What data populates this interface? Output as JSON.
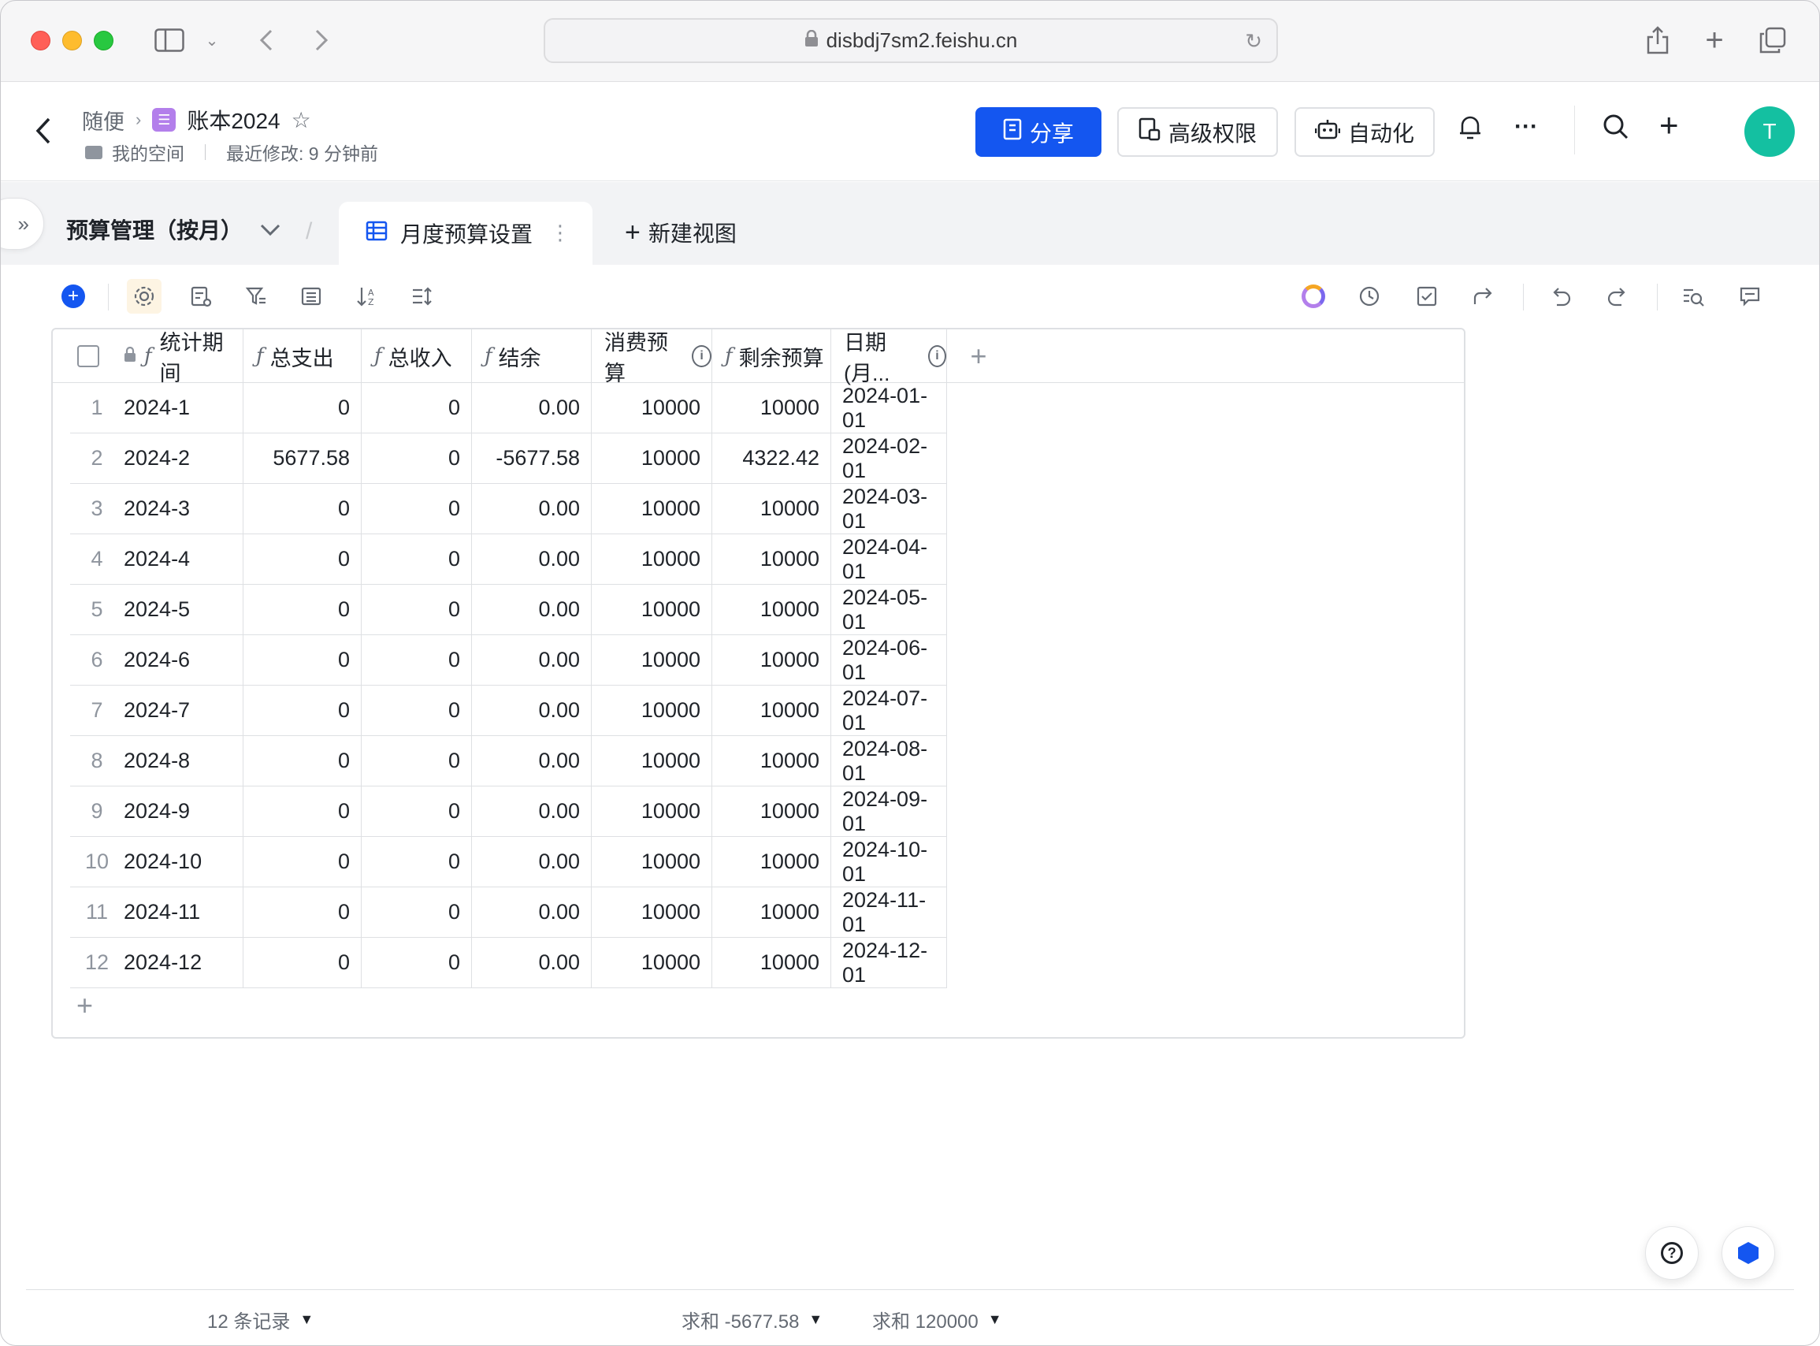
{
  "browser": {
    "url": "disbdj7sm2.feishu.cn"
  },
  "header": {
    "breadcrumb_parent": "随便",
    "doc_title": "账本2024",
    "space_name": "我的空间",
    "last_modified": "最近修改: 9 分钟前",
    "share_label": "分享",
    "permissions_label": "高级权限",
    "automation_label": "自动化",
    "avatar_initial": "T",
    "more_label": "···"
  },
  "tabs": {
    "table_name": "预算管理（按月）",
    "active_view": "月度预算设置",
    "new_view_label": "新建视图"
  },
  "grid": {
    "columns": [
      {
        "label": "统计期间",
        "formula": true,
        "locked": true
      },
      {
        "label": "总支出",
        "formula": true
      },
      {
        "label": "总收入",
        "formula": true
      },
      {
        "label": "结余",
        "formula": true
      },
      {
        "label": "消费预算",
        "info": true
      },
      {
        "label": "剩余预算",
        "formula": true
      },
      {
        "label": "日期(月...",
        "info": true
      }
    ],
    "rows": [
      {
        "n": "1",
        "period": "2024-1",
        "expense": "0",
        "income": "0",
        "balance": "0.00",
        "budget": "10000",
        "remaining": "10000",
        "date": "2024-01-01"
      },
      {
        "n": "2",
        "period": "2024-2",
        "expense": "5677.58",
        "income": "0",
        "balance": "-5677.58",
        "budget": "10000",
        "remaining": "4322.42",
        "date": "2024-02-01"
      },
      {
        "n": "3",
        "period": "2024-3",
        "expense": "0",
        "income": "0",
        "balance": "0.00",
        "budget": "10000",
        "remaining": "10000",
        "date": "2024-03-01"
      },
      {
        "n": "4",
        "period": "2024-4",
        "expense": "0",
        "income": "0",
        "balance": "0.00",
        "budget": "10000",
        "remaining": "10000",
        "date": "2024-04-01"
      },
      {
        "n": "5",
        "period": "2024-5",
        "expense": "0",
        "income": "0",
        "balance": "0.00",
        "budget": "10000",
        "remaining": "10000",
        "date": "2024-05-01"
      },
      {
        "n": "6",
        "period": "2024-6",
        "expense": "0",
        "income": "0",
        "balance": "0.00",
        "budget": "10000",
        "remaining": "10000",
        "date": "2024-06-01"
      },
      {
        "n": "7",
        "period": "2024-7",
        "expense": "0",
        "income": "0",
        "balance": "0.00",
        "budget": "10000",
        "remaining": "10000",
        "date": "2024-07-01"
      },
      {
        "n": "8",
        "period": "2024-8",
        "expense": "0",
        "income": "0",
        "balance": "0.00",
        "budget": "10000",
        "remaining": "10000",
        "date": "2024-08-01"
      },
      {
        "n": "9",
        "period": "2024-9",
        "expense": "0",
        "income": "0",
        "balance": "0.00",
        "budget": "10000",
        "remaining": "10000",
        "date": "2024-09-01"
      },
      {
        "n": "10",
        "period": "2024-10",
        "expense": "0",
        "income": "0",
        "balance": "0.00",
        "budget": "10000",
        "remaining": "10000",
        "date": "2024-10-01"
      },
      {
        "n": "11",
        "period": "2024-11",
        "expense": "0",
        "income": "0",
        "balance": "0.00",
        "budget": "10000",
        "remaining": "10000",
        "date": "2024-11-01"
      },
      {
        "n": "12",
        "period": "2024-12",
        "expense": "0",
        "income": "0",
        "balance": "0.00",
        "budget": "10000",
        "remaining": "10000",
        "date": "2024-12-01"
      }
    ]
  },
  "footer": {
    "record_count": "12 条记录",
    "sum_balance": "求和 -5677.58",
    "sum_budget": "求和 120000"
  },
  "colors": {
    "accent": "#1456f0",
    "avatar": "#14c0a1",
    "doc_icon": "#b37feb"
  }
}
